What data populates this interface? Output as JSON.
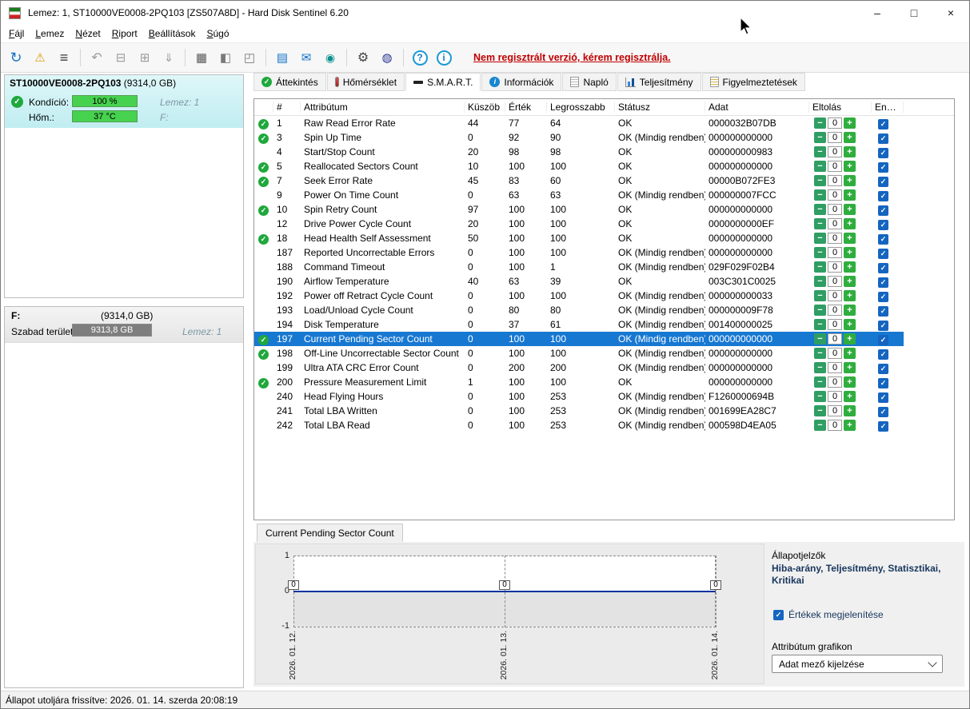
{
  "window": {
    "title": "Lemez: 1, ST10000VE0008-2PQ103 [ZS507A8D]  -  Hard Disk Sentinel 6.20",
    "controls": {
      "minimize": "–",
      "maximize": "□",
      "close": "×"
    }
  },
  "menu": {
    "items": [
      "Fájl",
      "Lemez",
      "Nézet",
      "Riport",
      "Beállítások",
      "Súgó"
    ]
  },
  "toolbar": {
    "icons": [
      "refresh",
      "status-gauge",
      "report-list",
      "|",
      "undo",
      "disk-remove",
      "disk-accept",
      "disk-download",
      "|",
      "printer",
      "disk-tools",
      "disk-package",
      "|",
      "hardware-notes",
      "email",
      "remote-webcam",
      "|",
      "settings-gear",
      "online-disk",
      "|",
      "help",
      "info"
    ],
    "register_text": "Nem regisztrált verzió, kérem regisztrálja."
  },
  "sidebar": {
    "disk": {
      "name": "ST10000VE0008-2PQ103",
      "size": "(9314,0 GB)",
      "condition_label": "Kondíció:",
      "condition_value": "100 %",
      "disk_label": "Lemez: 1",
      "temp_label": "Hőm.:",
      "temp_value": "37 °C",
      "volume_label": "F:"
    },
    "partition": {
      "name": "F:",
      "size": "(9314,0 GB)",
      "free_label": "Szabad terület",
      "free_value": "9313,8 GB",
      "disk_label": "Lemez: 1"
    }
  },
  "tabs": [
    {
      "label": "Áttekintés",
      "icon": "check",
      "active": false
    },
    {
      "label": "Hőmérséklet",
      "icon": "thermo",
      "active": false
    },
    {
      "label": "S.M.A.R.T.",
      "icon": "smart",
      "active": true
    },
    {
      "label": "Információk",
      "icon": "info",
      "active": false
    },
    {
      "label": "Napló",
      "icon": "log",
      "active": false
    },
    {
      "label": "Teljesítmény",
      "icon": "chart",
      "active": false
    },
    {
      "label": "Figyelmeztetések",
      "icon": "alert",
      "active": false
    }
  ],
  "table": {
    "headers": [
      "#",
      "Attribútum",
      "Küszöb",
      "Érték",
      "Legrosszabb",
      "Státusz",
      "Adat",
      "Eltolás",
      "Enge..."
    ],
    "selected_id": "197",
    "rows": [
      {
        "check": true,
        "id": "1",
        "name": "Raw Read Error Rate",
        "threshold": "44",
        "value": "77",
        "worst": "64",
        "status": "OK",
        "data": "0000032B07DB",
        "offset": "0"
      },
      {
        "check": true,
        "id": "3",
        "name": "Spin Up Time",
        "threshold": "0",
        "value": "92",
        "worst": "90",
        "status": "OK (Mindig rendben)",
        "data": "000000000000",
        "offset": "0"
      },
      {
        "check": false,
        "id": "4",
        "name": "Start/Stop Count",
        "threshold": "20",
        "value": "98",
        "worst": "98",
        "status": "OK",
        "data": "000000000983",
        "offset": "0"
      },
      {
        "check": true,
        "id": "5",
        "name": "Reallocated Sectors Count",
        "threshold": "10",
        "value": "100",
        "worst": "100",
        "status": "OK",
        "data": "000000000000",
        "offset": "0"
      },
      {
        "check": true,
        "id": "7",
        "name": "Seek Error Rate",
        "threshold": "45",
        "value": "83",
        "worst": "60",
        "status": "OK",
        "data": "00000B072FE3",
        "offset": "0"
      },
      {
        "check": false,
        "id": "9",
        "name": "Power On Time Count",
        "threshold": "0",
        "value": "63",
        "worst": "63",
        "status": "OK (Mindig rendben)",
        "data": "000000007FCC",
        "offset": "0"
      },
      {
        "check": true,
        "id": "10",
        "name": "Spin Retry Count",
        "threshold": "97",
        "value": "100",
        "worst": "100",
        "status": "OK",
        "data": "000000000000",
        "offset": "0"
      },
      {
        "check": false,
        "id": "12",
        "name": "Drive Power Cycle Count",
        "threshold": "20",
        "value": "100",
        "worst": "100",
        "status": "OK",
        "data": "0000000000EF",
        "offset": "0"
      },
      {
        "check": true,
        "id": "18",
        "name": "Head Health Self Assessment",
        "threshold": "50",
        "value": "100",
        "worst": "100",
        "status": "OK",
        "data": "000000000000",
        "offset": "0"
      },
      {
        "check": false,
        "id": "187",
        "name": "Reported Uncorrectable Errors",
        "threshold": "0",
        "value": "100",
        "worst": "100",
        "status": "OK (Mindig rendben)",
        "data": "000000000000",
        "offset": "0"
      },
      {
        "check": false,
        "id": "188",
        "name": "Command Timeout",
        "threshold": "0",
        "value": "100",
        "worst": "1",
        "status": "OK (Mindig rendben)",
        "data": "029F029F02B4",
        "offset": "0"
      },
      {
        "check": false,
        "id": "190",
        "name": "Airflow Temperature",
        "threshold": "40",
        "value": "63",
        "worst": "39",
        "status": "OK",
        "data": "003C301C0025",
        "offset": "0"
      },
      {
        "check": false,
        "id": "192",
        "name": "Power off Retract Cycle Count",
        "threshold": "0",
        "value": "100",
        "worst": "100",
        "status": "OK (Mindig rendben)",
        "data": "000000000033",
        "offset": "0"
      },
      {
        "check": false,
        "id": "193",
        "name": "Load/Unload Cycle Count",
        "threshold": "0",
        "value": "80",
        "worst": "80",
        "status": "OK (Mindig rendben)",
        "data": "000000009F78",
        "offset": "0"
      },
      {
        "check": false,
        "id": "194",
        "name": "Disk Temperature",
        "threshold": "0",
        "value": "37",
        "worst": "61",
        "status": "OK (Mindig rendben)",
        "data": "001400000025",
        "offset": "0"
      },
      {
        "check": true,
        "id": "197",
        "name": "Current Pending Sector Count",
        "threshold": "0",
        "value": "100",
        "worst": "100",
        "status": "OK (Mindig rendben)",
        "data": "000000000000",
        "offset": "0"
      },
      {
        "check": true,
        "id": "198",
        "name": "Off-Line Uncorrectable Sector Count",
        "threshold": "0",
        "value": "100",
        "worst": "100",
        "status": "OK (Mindig rendben)",
        "data": "000000000000",
        "offset": "0"
      },
      {
        "check": false,
        "id": "199",
        "name": "Ultra ATA CRC Error Count",
        "threshold": "0",
        "value": "200",
        "worst": "200",
        "status": "OK (Mindig rendben)",
        "data": "000000000000",
        "offset": "0"
      },
      {
        "check": true,
        "id": "200",
        "name": "Pressure Measurement Limit",
        "threshold": "1",
        "value": "100",
        "worst": "100",
        "status": "OK",
        "data": "000000000000",
        "offset": "0"
      },
      {
        "check": false,
        "id": "240",
        "name": "Head Flying Hours",
        "threshold": "0",
        "value": "100",
        "worst": "253",
        "status": "OK (Mindig rendben)",
        "data": "F1260000694B",
        "offset": "0"
      },
      {
        "check": false,
        "id": "241",
        "name": "Total LBA Written",
        "threshold": "0",
        "value": "100",
        "worst": "253",
        "status": "OK (Mindig rendben)",
        "data": "001699EA28C7",
        "offset": "0"
      },
      {
        "check": false,
        "id": "242",
        "name": "Total LBA Read",
        "threshold": "0",
        "value": "100",
        "worst": "253",
        "status": "OK (Mindig rendben)",
        "data": "000598D4EA05",
        "offset": "0"
      }
    ]
  },
  "detail": {
    "tab_label": "Current Pending Sector Count"
  },
  "chart": {
    "y_ticks": [
      "1",
      "0",
      "-1"
    ],
    "x_dates": [
      "2026. 01. 12.",
      "2026. 01. 13.",
      "2026. 01. 14."
    ],
    "values": [
      "0",
      "0",
      "0"
    ],
    "line_color": "#0033a0"
  },
  "right_panel": {
    "title": "Állapotjelzők",
    "categories": "Hiba-arány, Teljesítmény, Statisztikai, Kritikai",
    "show_values_label": "Értékek megjelenítése",
    "graph_label": "Attribútum grafikon",
    "dropdown_value": "Adat mező kijelzése"
  },
  "statusbar": {
    "text": "Állapot utoljára frissítve: 2026. 01. 14. szerda 20:08:19"
  },
  "colors": {
    "selection_blue": "#1778d2",
    "ok_green": "#1fa83c",
    "checkbox_blue": "#1565c0",
    "register_red": "#c00000",
    "disk_panel_cyan": "#c0edf1",
    "chart_line_navy": "#0033a0"
  }
}
